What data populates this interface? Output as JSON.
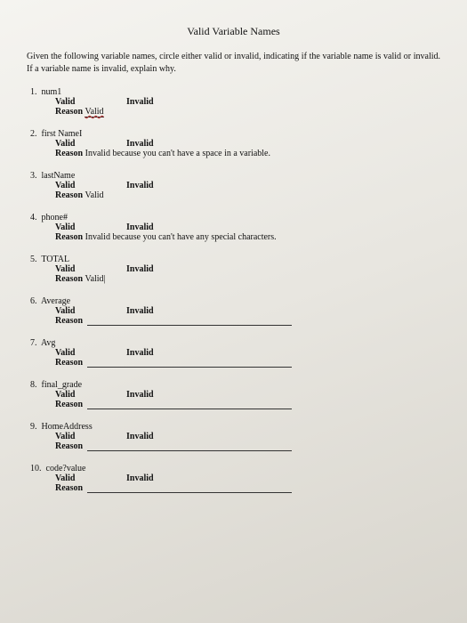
{
  "title": "Valid Variable Names",
  "instructions": "Given the following variable names, circle either valid or invalid, indicating if the variable name is valid or invalid.  If a variable name is invalid, explain why.",
  "validLabel": "Valid",
  "invalidLabel": "Invalid",
  "reasonLabel": "Reason",
  "items": [
    {
      "num": "1.",
      "name": "num1",
      "reason": "Valid",
      "reasonStyle": "wavy"
    },
    {
      "num": "2.",
      "name": "first Name",
      "reason": "Invalid because you can't have a space in a variable.",
      "cursorAfterName": true
    },
    {
      "num": "3.",
      "name": "lastName",
      "reason": "Valid"
    },
    {
      "num": "4.",
      "name": "phone#",
      "reason": "Invalid because you can't have any special characters."
    },
    {
      "num": "5.",
      "name": "TOTAL",
      "reason": "Valid",
      "cursorAfterReason": true
    },
    {
      "num": "6.",
      "name": "Average",
      "reason": "",
      "blank": true
    },
    {
      "num": "7.",
      "name": "Avg",
      "reason": "",
      "blank": true
    },
    {
      "num": "8.",
      "name": "final_grade",
      "reason": "",
      "blank": true
    },
    {
      "num": "9.",
      "name": "HomeAddress",
      "reason": "",
      "blank": true
    },
    {
      "num": "10.",
      "name": "code?value",
      "reason": "",
      "blank": true
    }
  ]
}
